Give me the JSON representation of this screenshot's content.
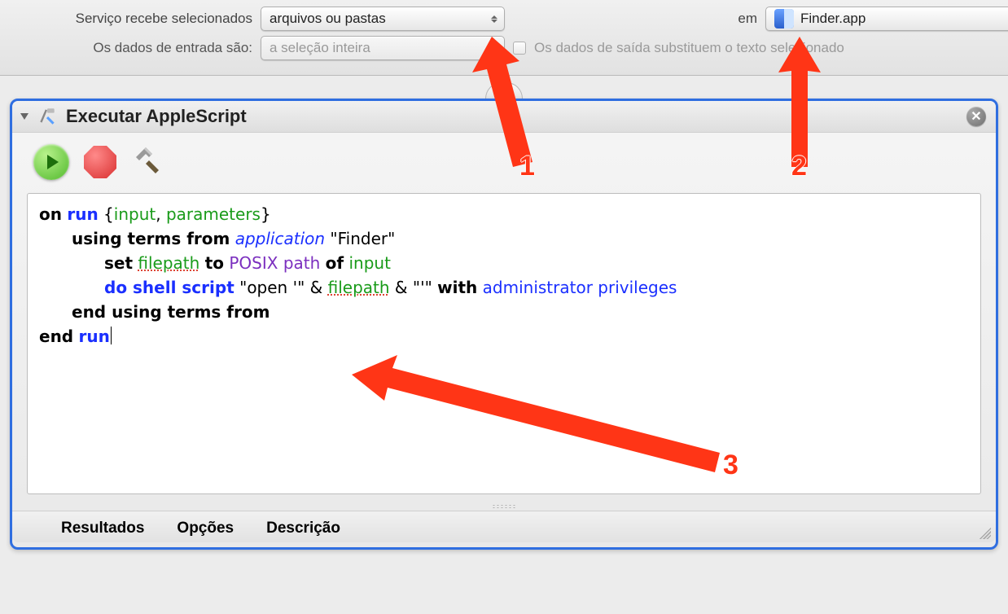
{
  "config": {
    "recebe_label": "Serviço recebe selecionados",
    "input_type_value": "arquivos ou pastas",
    "em_label": "em",
    "app_value": "Finder.app",
    "dados_entrada_label": "Os dados de entrada são:",
    "data_input_value": "a seleção inteira",
    "output_replace_label": "Os dados de saída substituem o texto selecionado"
  },
  "step": {
    "title": "Executar AppleScript",
    "tabs": {
      "resultados": "Resultados",
      "opcoes": "Opções",
      "descricao": "Descrição"
    }
  },
  "code": {
    "l1_on": "on",
    "l1_run": "run",
    "l1_brace_open": "{",
    "l1_input": "input",
    "l1_comma": ",",
    "l1_parameters": "parameters",
    "l1_brace_close": "}",
    "l2_using_terms_from": "using terms from",
    "l2_application": "application",
    "l2_str": "\"Finder\"",
    "l3_set": "set",
    "l3_filepath": "filepath",
    "l3_to": "to",
    "l3_posix_path": "POSIX path",
    "l3_of": "of",
    "l3_input": "input",
    "l4_do_shell_script": "do shell script",
    "l4_str1": "\"open '\"",
    "l4_amp1": "&",
    "l4_filepath": "filepath",
    "l4_amp2": "&",
    "l4_str2": "\"'\"",
    "l4_with": "with",
    "l4_admin_priv": "administrator privileges",
    "l5_end_using": "end using terms from",
    "l6_end": "end",
    "l6_run": "run"
  },
  "annotations": {
    "n1": "1",
    "n2": "2",
    "n3": "3"
  }
}
